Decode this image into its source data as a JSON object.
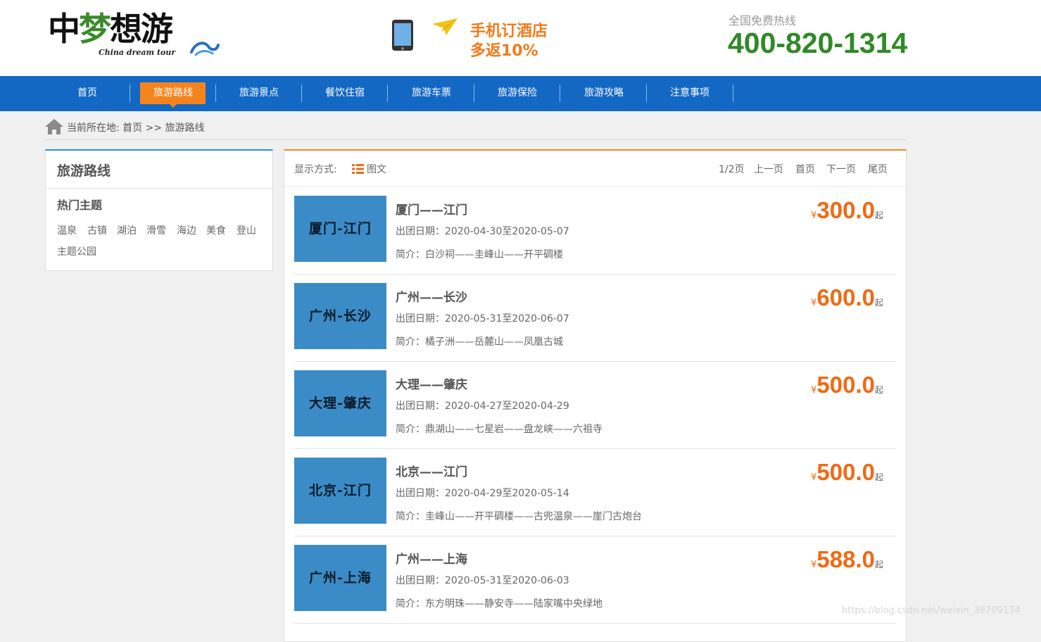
{
  "header": {
    "logo_main_black1": "中",
    "logo_main_green": "梦",
    "logo_main_black2": "想游",
    "logo_sub": "China dream tour",
    "promo_line1": "手机订酒店",
    "promo_line2": "多返10%",
    "hotline_label": "全国免费热线",
    "hotline_number": "400-820-1314"
  },
  "nav": {
    "items": [
      {
        "label": "首页"
      },
      {
        "label": "旅游路线"
      },
      {
        "label": "旅游景点"
      },
      {
        "label": "餐饮住宿"
      },
      {
        "label": "旅游车票"
      },
      {
        "label": "旅游保险"
      },
      {
        "label": "旅游攻略"
      },
      {
        "label": "注意事项"
      }
    ],
    "active": "旅游路线"
  },
  "breadcrumb": {
    "text": "当前所在地:  首页 >> 旅游路线"
  },
  "sidebar": {
    "title": "旅游路线",
    "subtitle": "热门主题",
    "tags": [
      "温泉",
      "古镇",
      "湖泊",
      "滑雪",
      "海边",
      "美食",
      "登山",
      "主题公园"
    ]
  },
  "toolbar": {
    "display_label": "显示方式:",
    "view_label": "图文",
    "pager": {
      "page_info": "1/2页",
      "prev": "上一页",
      "first": "首页",
      "next": "下一页",
      "last": "尾页"
    }
  },
  "routes": [
    {
      "thumb": "厦门-江门",
      "title": "厦门——江门",
      "date": "出团日期：2020-04-30至2020-05-07",
      "desc": "简介：白沙祠——圭峰山——开平碉楼",
      "currency": "¥",
      "price": "300.0",
      "suffix": "起"
    },
    {
      "thumb": "广州-长沙",
      "title": "广州——长沙",
      "date": "出团日期：2020-05-31至2020-06-07",
      "desc": "简介：橘子洲——岳麓山——凤凰古城",
      "currency": "¥",
      "price": "600.0",
      "suffix": "起"
    },
    {
      "thumb": "大理-肇庆",
      "title": "大理——肇庆",
      "date": "出团日期：2020-04-27至2020-04-29",
      "desc": "简介：鼎湖山——七星岩——盘龙峡——六祖寺",
      "currency": "¥",
      "price": "500.0",
      "suffix": "起"
    },
    {
      "thumb": "北京-江门",
      "title": "北京——江门",
      "date": "出团日期：2020-04-29至2020-05-14",
      "desc": "简介：圭峰山——开平碉楼——古兜温泉——崖门古炮台",
      "currency": "¥",
      "price": "500.0",
      "suffix": "起"
    },
    {
      "thumb": "广州-上海",
      "title": "广州——上海",
      "date": "出团日期：2020-05-31至2020-06-03",
      "desc": "简介：东方明珠——静安寺——陆家嘴中央绿地",
      "currency": "¥",
      "price": "588.0",
      "suffix": "起"
    }
  ],
  "watermark": "https://blog.csdn.net/weixin_39709134",
  "colors": {
    "nav_bg": "#1368c4",
    "nav_active": "#f5841f",
    "price": "#f06a14",
    "hotline": "#2f8a26",
    "thumb_bg": "#3b8cc6"
  }
}
